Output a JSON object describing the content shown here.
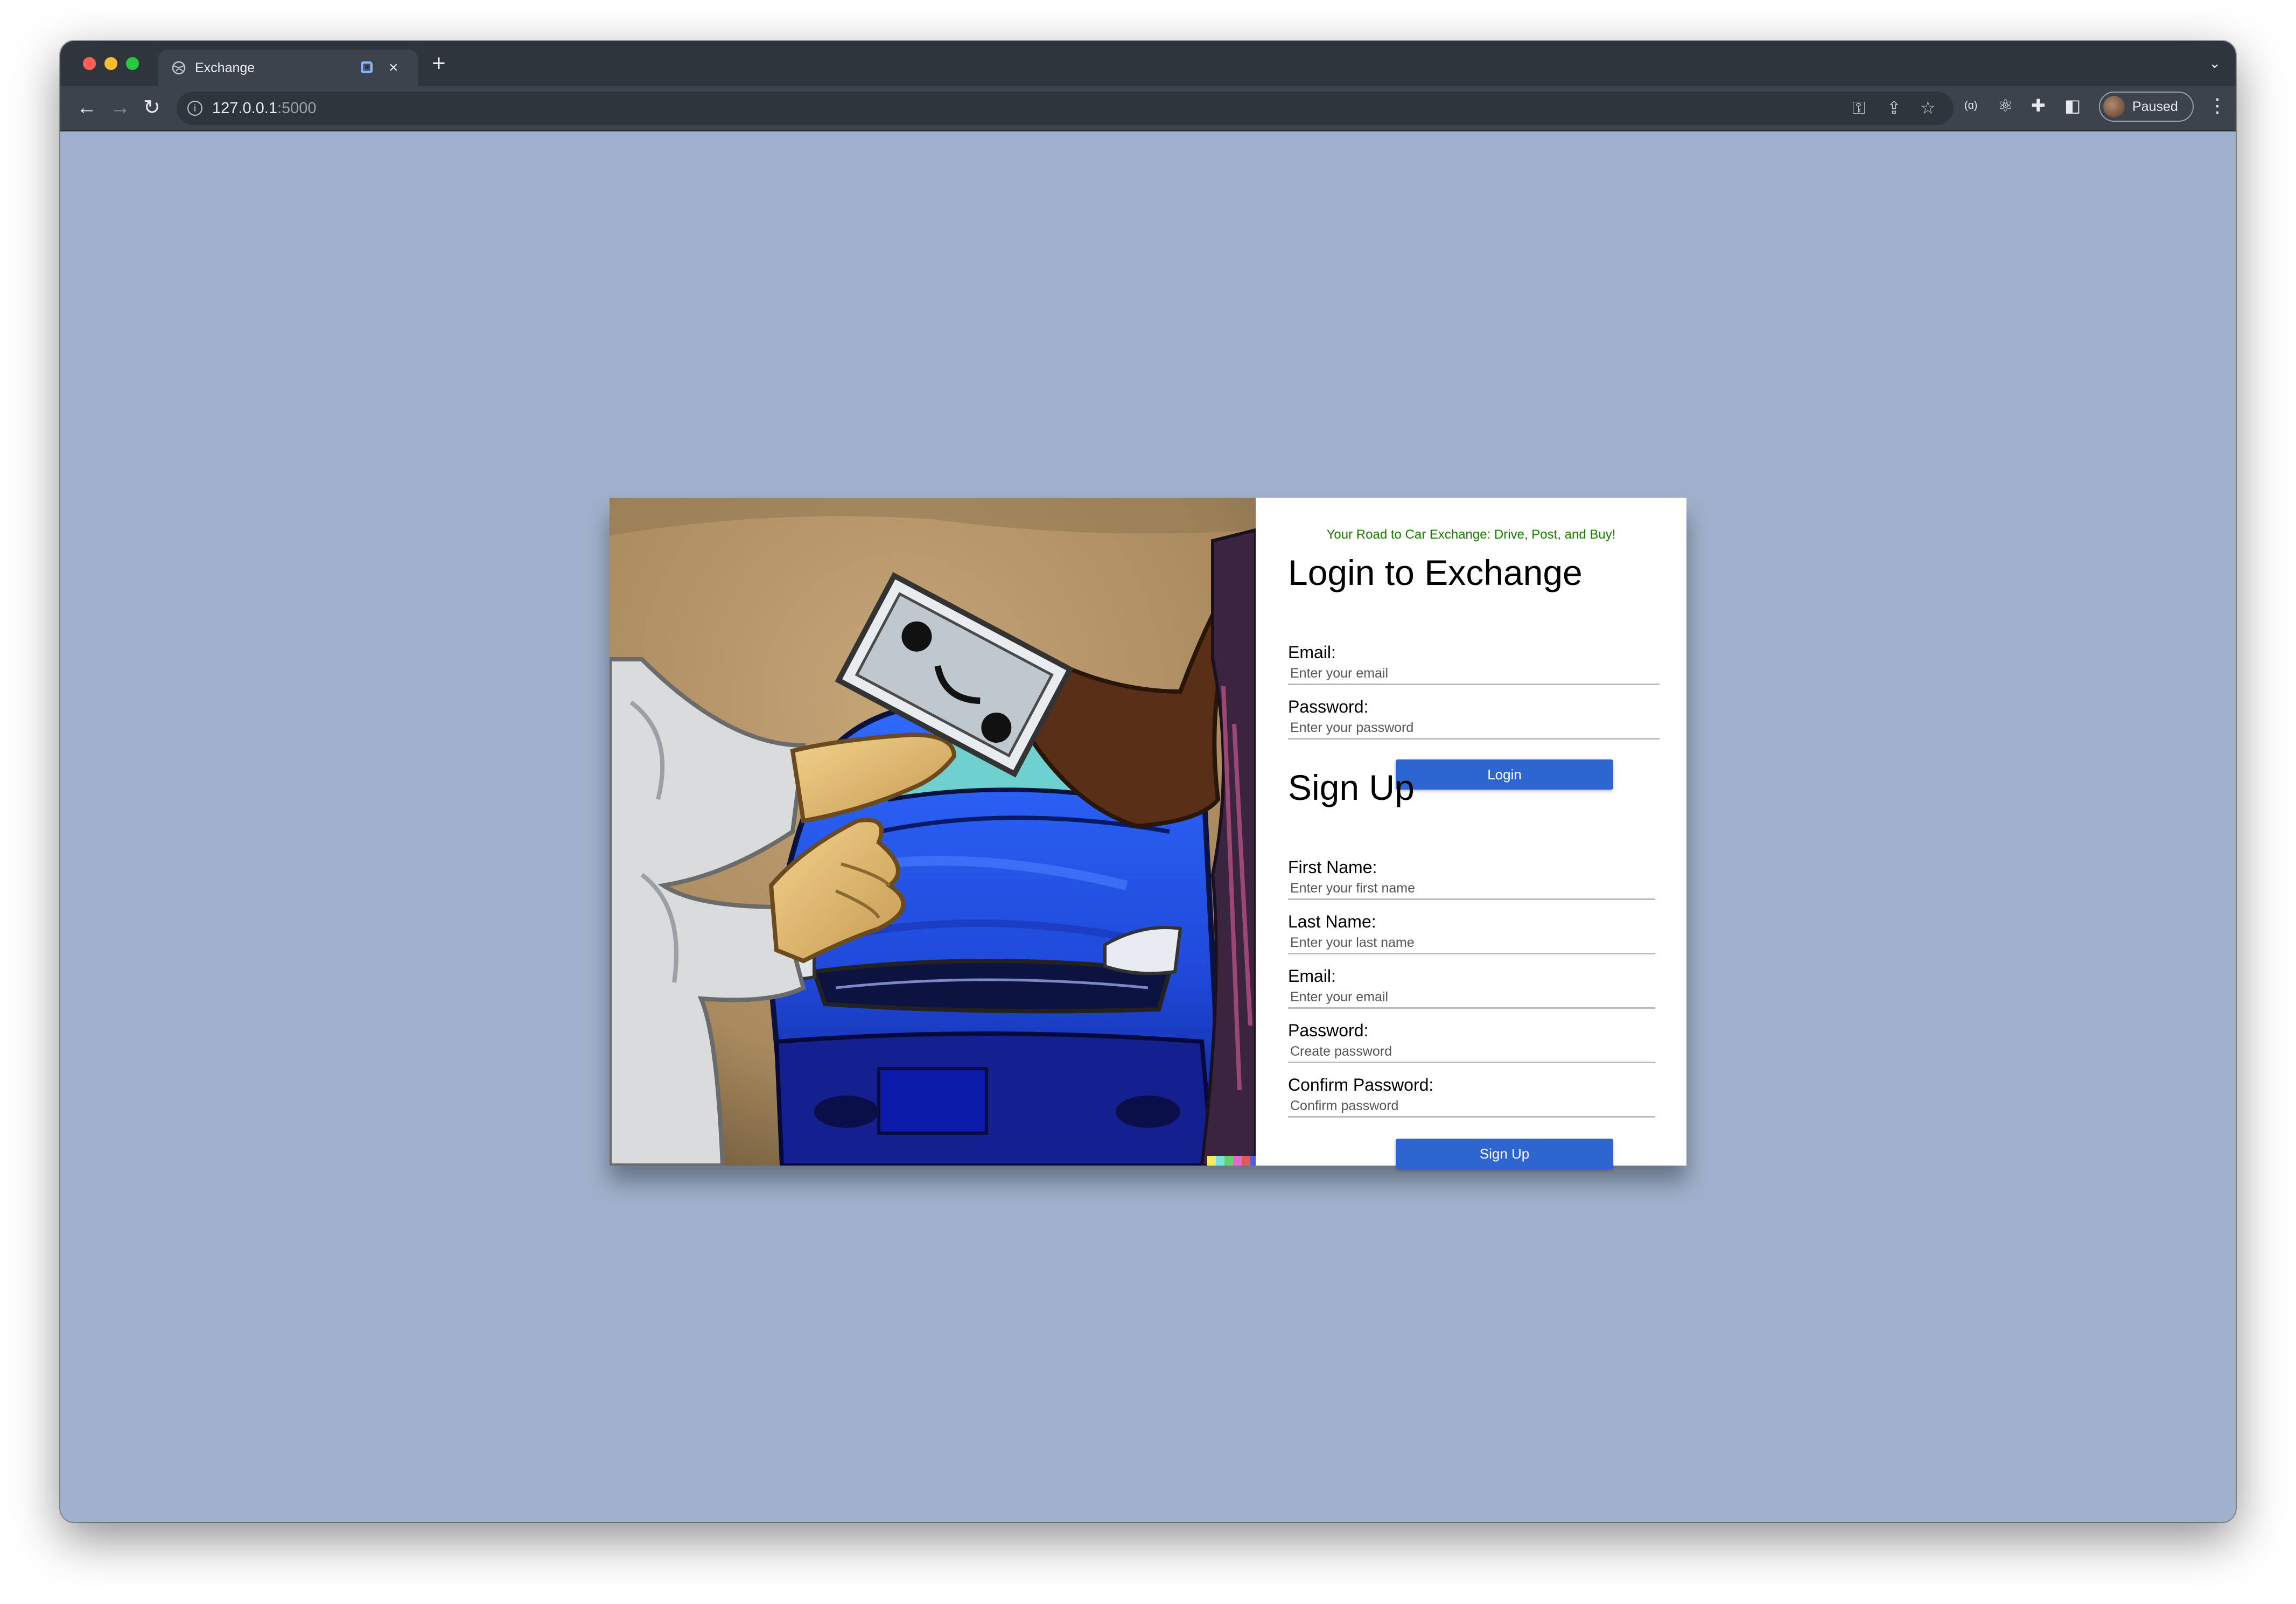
{
  "browser": {
    "tab_title": "Exchange",
    "tab_close": "×",
    "new_tab": "+",
    "tab_menu": "⌄",
    "url_host": "127.0.0.1",
    "url_port": ":5000",
    "profile_label": "Paused",
    "icons": [
      "back-icon",
      "forward-icon",
      "reload-icon",
      "info-icon",
      "key-icon",
      "share-icon",
      "star-icon",
      "extension-icon",
      "react-icon",
      "puzzle-icon",
      "sidepanel-icon",
      "menu-icon"
    ]
  },
  "page": {
    "background": "#9fb1cc",
    "accent": "#2d66d0",
    "tagline_color": "#1a7a00",
    "tagline": "Your Road to Car Exchange: Drive, Post, and Buy!",
    "login": {
      "title": "Login to Exchange",
      "email_label": "Email:",
      "email_placeholder": "Enter your email",
      "password_label": "Password:",
      "password_placeholder": "Enter your password",
      "button": "Login"
    },
    "signup": {
      "title": "Sign Up",
      "first_name_label": "First Name:",
      "first_name_placeholder": "Enter your first name",
      "last_name_label": "Last Name:",
      "last_name_placeholder": "Enter your last name",
      "email_label": "Email:",
      "email_placeholder": "Enter your email",
      "password_label": "Password:",
      "password_placeholder": "Create password",
      "confirm_label": "Confirm Password:",
      "confirm_placeholder": "Confirm password",
      "button": "Sign Up"
    }
  }
}
